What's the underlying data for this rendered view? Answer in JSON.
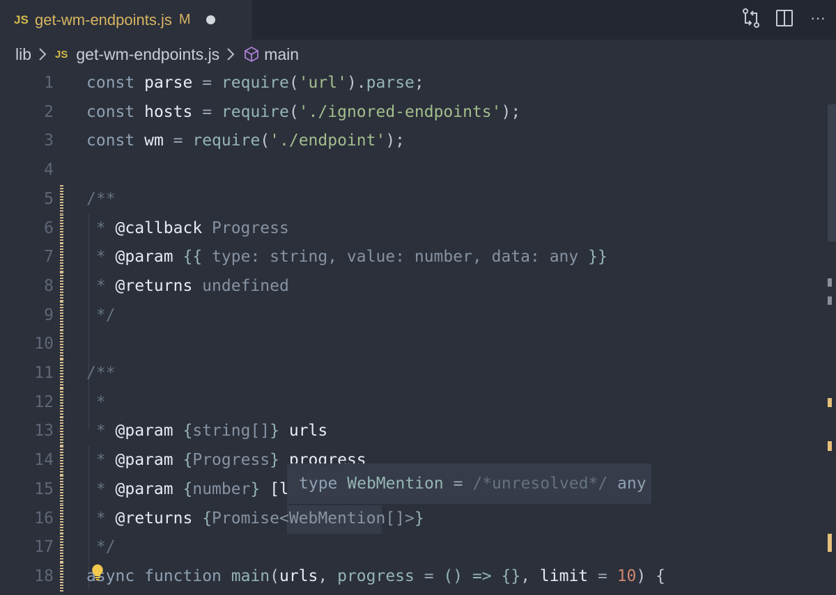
{
  "tab": {
    "js_badge": "JS",
    "filename": "get-wm-endpoints.js",
    "status": "M"
  },
  "toolbar": {
    "actions": [
      {
        "icon": "compare-changes-icon"
      },
      {
        "icon": "split-editor-icon"
      },
      {
        "icon": "more-actions-icon",
        "label": "···"
      }
    ]
  },
  "breadcrumb": {
    "folder": "lib",
    "js_badge": "JS",
    "file": "get-wm-endpoints.js",
    "symbol": "main"
  },
  "line_numbers": [
    "1",
    "2",
    "3",
    "4",
    "5",
    "6",
    "7",
    "8",
    "9",
    "10",
    "11",
    "12",
    "13",
    "14",
    "15",
    "16",
    "17",
    "18"
  ],
  "code": {
    "l1": [
      "const",
      " ",
      "parse",
      " = ",
      "require",
      "(",
      "'url'",
      ").",
      "parse",
      ";"
    ],
    "l2": [
      "const",
      " ",
      "hosts",
      " = ",
      "require",
      "(",
      "'./ignored-endpoints'",
      ");"
    ],
    "l3": [
      "const",
      " ",
      "wm",
      " = ",
      "require",
      "(",
      "'./endpoint'",
      ");"
    ],
    "l5": "/**",
    "l6": [
      " * ",
      "@callback",
      " Progress"
    ],
    "l7": [
      " * ",
      "@param",
      " ",
      "{{",
      " type: string, value: number, data: any ",
      "}}"
    ],
    "l8": [
      " * ",
      "@returns",
      " undefined"
    ],
    "l9": " */",
    "l11": "/**",
    "l12": " *",
    "l13": [
      " * ",
      "@param",
      " ",
      "{",
      "string[]",
      "}",
      " urls"
    ],
    "l14": [
      " * ",
      "@param",
      " ",
      "{",
      "Progress",
      "}",
      " progress"
    ],
    "l15": [
      " * ",
      "@param",
      " ",
      "{",
      "number",
      "}",
      " [l"
    ],
    "l16": [
      " * ",
      "@returns",
      " ",
      "{",
      "Promise<WebMention[]>",
      "}"
    ],
    "l17": " */",
    "l18": [
      "async",
      " ",
      "function",
      " ",
      "main",
      "(",
      "urls",
      ", ",
      "progress",
      " = ",
      "() => {}",
      ", ",
      "limit",
      " = ",
      "10",
      ") {"
    ]
  },
  "hover": {
    "keyword": "type",
    "name": "WebMention",
    "op": "=",
    "comment": "/*unresolved*/",
    "type": "any"
  },
  "colors": {
    "background": "#2b303b",
    "tabbar": "#232731",
    "modified": "#d9b561",
    "lightbulb": "#f2c94c"
  }
}
